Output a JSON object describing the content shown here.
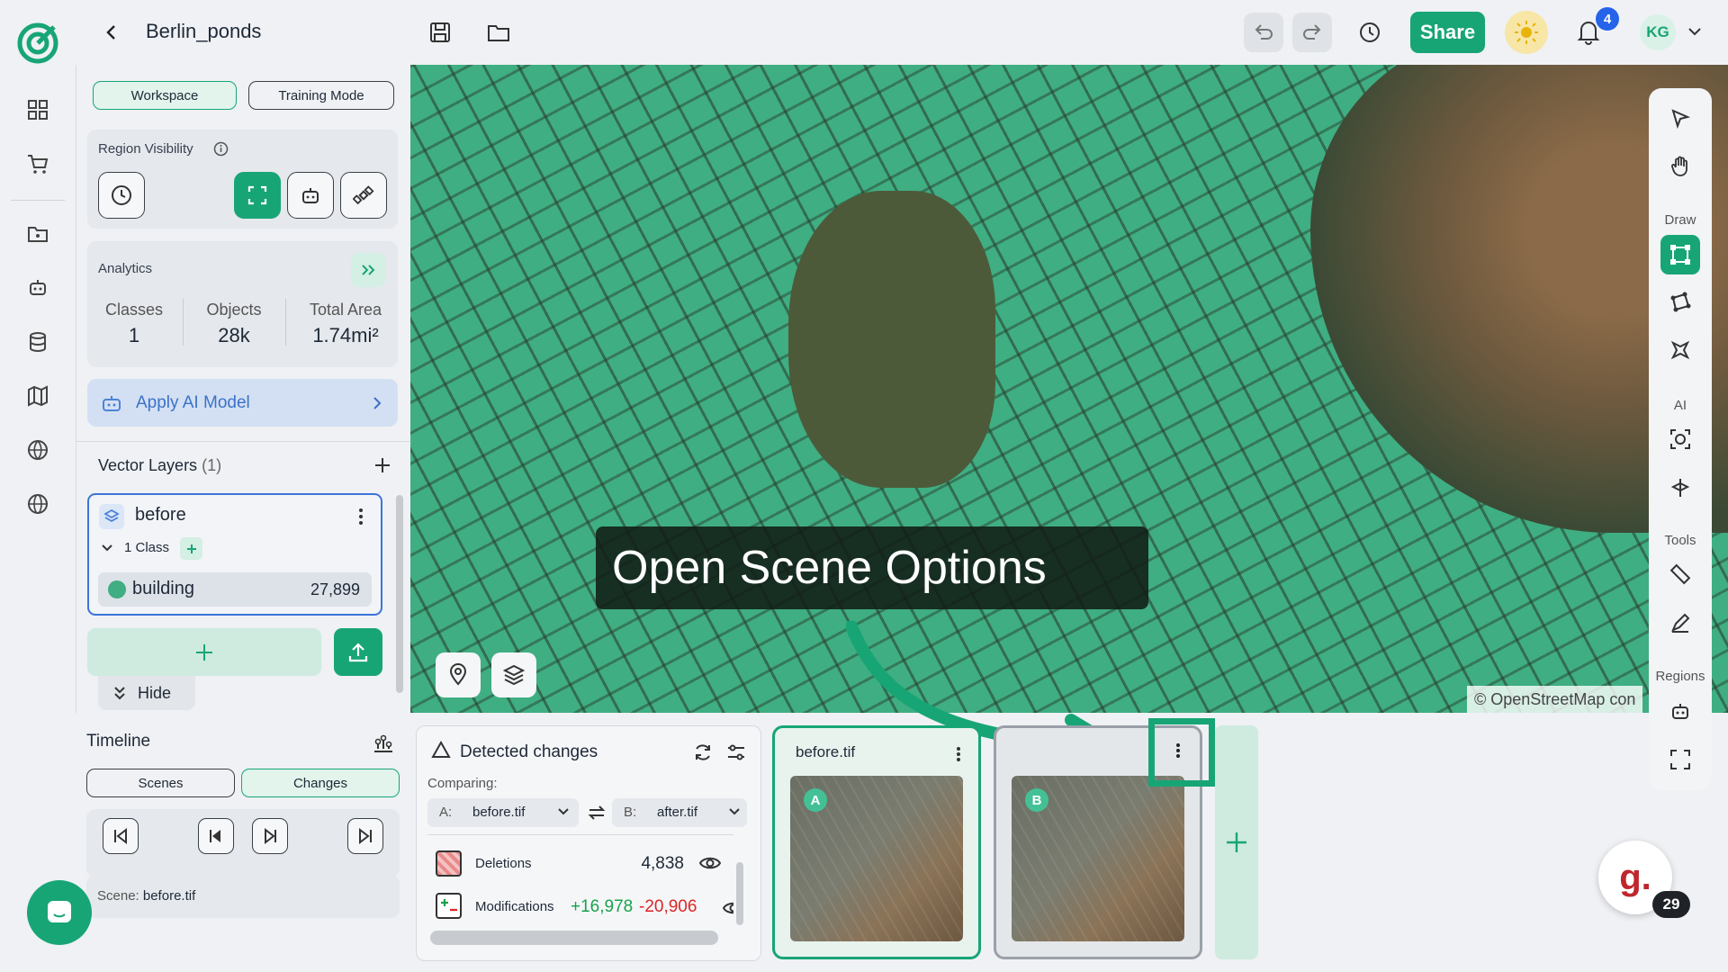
{
  "header": {
    "project_title": "Berlin_ponds",
    "share_label": "Share",
    "notification_count": "4",
    "user_initials": "KG"
  },
  "panel": {
    "tabs": {
      "workspace": "Workspace",
      "training": "Training Mode"
    },
    "region_visibility_label": "Region Visibility",
    "analytics": {
      "title": "Analytics",
      "classes_label": "Classes",
      "classes_value": "1",
      "objects_label": "Objects",
      "objects_value": "28k",
      "area_label": "Total Area",
      "area_value": "1.74mi²"
    },
    "apply_ai_label": "Apply AI Model",
    "vector_layers": {
      "title": "Vector Layers",
      "count": "(1)",
      "layer_name": "before",
      "class_count": "1 Class",
      "class_name": "building",
      "class_value": "27,899"
    },
    "hide_label": "Hide"
  },
  "map": {
    "caption": "Open Scene Options",
    "attribution": "© OpenStreetMap con"
  },
  "toolbar": {
    "draw_label": "Draw",
    "ai_label": "AI",
    "tools_label": "Tools",
    "regions_label": "Regions"
  },
  "timeline": {
    "title": "Timeline",
    "tabs": {
      "scenes": "Scenes",
      "changes": "Changes"
    },
    "scene_label": "Scene:",
    "scene_value": "before.tif"
  },
  "changes": {
    "title": "Detected changes",
    "comparing_label": "Comparing:",
    "a_prefix": "A:",
    "a_value": "before.tif",
    "b_prefix": "B:",
    "b_value": "after.tif",
    "deletions_label": "Deletions",
    "deletions_value": "4,838",
    "modifications_label": "Modifications",
    "modifications_plus": "+16,978",
    "modifications_minus": "-20,906"
  },
  "scenes": {
    "scene_a_name": "before.tif",
    "scene_a_badge": "A",
    "scene_b_badge": "B"
  },
  "widget": {
    "logo_letter": "g.",
    "count": "29"
  },
  "colors": {
    "accent": "#18a576",
    "building_overlay": "#3fae82",
    "plus_value": "#16a34a",
    "minus_value": "#dc2626"
  }
}
